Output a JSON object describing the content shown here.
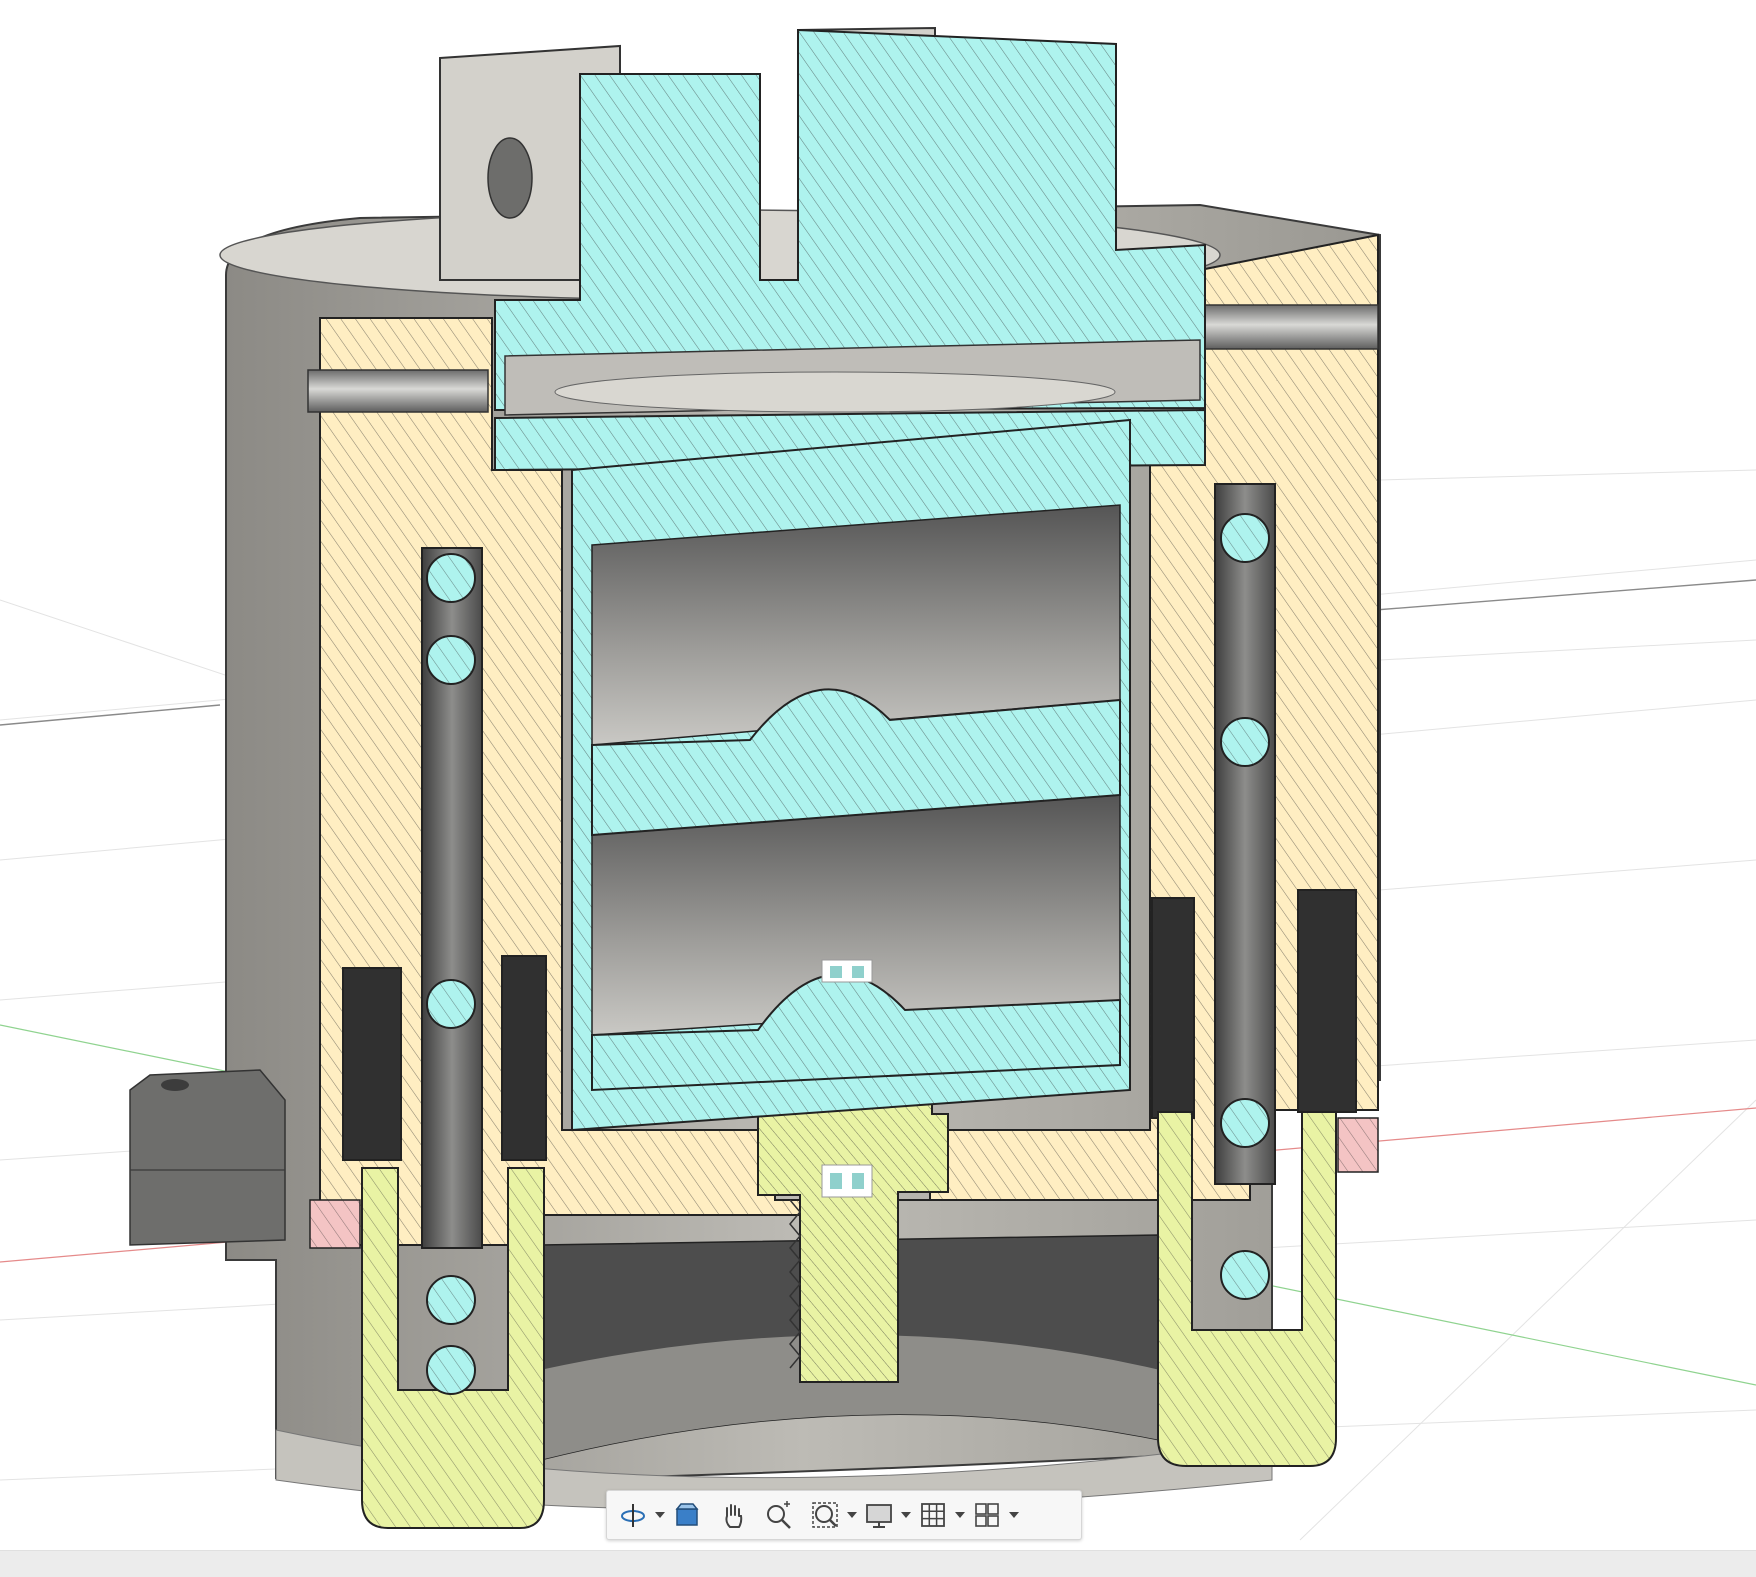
{
  "app": {
    "view": "section-analysis-3d-view"
  },
  "colors": {
    "background": "#ffffff",
    "body_shell": "#ffeec2",
    "inner_part": "#aef3ee",
    "screw_and_cup": "#e9f3a4",
    "hatch_line": "#333333",
    "body_gray": "#b8b6b0",
    "cavity_dark": "#4a4a4a",
    "ground_red": "#e07b7b",
    "ground_green": "#7bd17b"
  },
  "navigation_toolbar": {
    "tools": [
      {
        "icon": "orbit-icon",
        "has_menu": true
      },
      {
        "icon": "look-at-icon",
        "has_menu": false
      },
      {
        "icon": "pan-hand-icon",
        "has_menu": false
      },
      {
        "icon": "zoom-icon",
        "has_menu": false
      },
      {
        "icon": "fit-window-icon",
        "has_menu": true
      },
      {
        "icon": "display-settings-icon",
        "has_menu": true
      },
      {
        "icon": "grid-icon",
        "has_menu": true
      },
      {
        "icon": "viewports-icon",
        "has_menu": true
      }
    ]
  }
}
